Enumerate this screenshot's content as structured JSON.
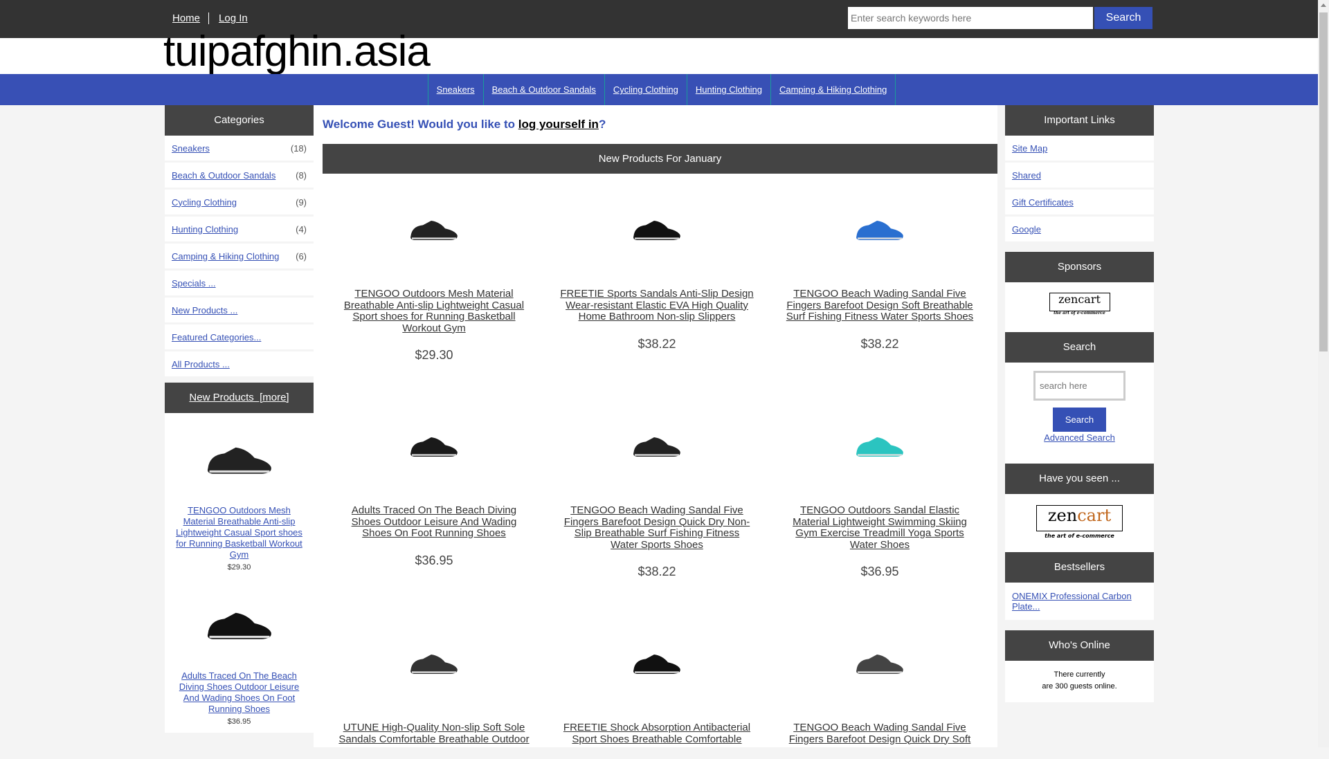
{
  "top": {
    "home": "Home",
    "login": "Log In",
    "search_placeholder": "Enter search keywords here",
    "search_btn": "Search"
  },
  "logo": "tuipafghin.asia",
  "nav": [
    "Sneakers",
    "Beach & Outdoor Sandals",
    "Cycling Clothing",
    "Hunting Clothing",
    "Camping & Hiking Clothing"
  ],
  "categories": {
    "title": "Categories",
    "items": [
      {
        "label": "Sneakers",
        "count": "(18)"
      },
      {
        "label": "Beach & Outdoor Sandals",
        "count": "(8)"
      },
      {
        "label": "Cycling Clothing",
        "count": "(9)"
      },
      {
        "label": "Hunting Clothing",
        "count": "(4)"
      },
      {
        "label": "Camping & Hiking Clothing",
        "count": "(6)"
      },
      {
        "label": "Specials ...",
        "count": ""
      },
      {
        "label": "New Products ...",
        "count": ""
      },
      {
        "label": "Featured Categories...",
        "count": ""
      },
      {
        "label": "All Products ...",
        "count": ""
      }
    ]
  },
  "side_new": {
    "title": "New Products  [more]",
    "items": [
      {
        "title": "TENGOO Outdoors Mesh Material Breathable Anti-slip Lightweight Casual Sport shoes for Running Basketball Workout Gym",
        "price": "$29.30"
      },
      {
        "title": "Adults Traced On The Beach Diving Shoes Outdoor Leisure And Wading Shoes On Foot Running Shoes",
        "price": "$36.95"
      }
    ]
  },
  "welcome": {
    "text": "Welcome Guest! Would you like to ",
    "link": "log yourself in",
    "end": "?"
  },
  "new_products": {
    "title": "New Products For January",
    "items": [
      {
        "title": "TENGOO Outdoors Mesh Material Breathable Anti-slip Lightweight Casual Sport shoes for Running Basketball Workout Gym",
        "price": "$29.30",
        "color": "#222"
      },
      {
        "title": "FREETIE Sports Sandals Anti-Slip Design Wear-resistant Elastic EVA High Quality Home Bathroom Non-slip Slippers",
        "price": "$38.22",
        "color": "#111"
      },
      {
        "title": "TENGOO Beach Wading Sandal Five Fingers Barefoot Design Soft Breathable Surf Fishing Fitness Water Sports Shoes",
        "price": "$38.22",
        "color": "#2a6fd0"
      },
      {
        "title": "Adults Traced On The Beach Diving Shoes Outdoor Leisure And Wading Shoes On Foot Running Shoes",
        "price": "$36.95",
        "color": "#1a1a1a"
      },
      {
        "title": "TENGOO Beach Wading Sandal Five Fingers Barefoot Design Quick Dry Non-Slip Breathable Surf Fishing Fitness Water Sports Shoes",
        "price": "$38.22",
        "color": "#222"
      },
      {
        "title": "TENGOO Outdoors Sandal Elastic Material Lightweight Swimming Skiing Gym Exercise Treadmill Yoga Sports Water Shoes",
        "price": "$36.95",
        "color": "#2bc4c0"
      },
      {
        "title": "UTUNE High-Quality Non-slip Soft Sole Sandals Comfortable Breathable Outdoor",
        "price": "",
        "color": "#333"
      },
      {
        "title": "FREETIE Shock Absorption Antibacterial Sport Shoes Breathable Comfortable",
        "price": "",
        "color": "#111"
      },
      {
        "title": "TENGOO Beach Wading Sandal Five Fingers Barefoot Design Quick Dry Soft",
        "price": "",
        "color": "#444"
      }
    ]
  },
  "important": {
    "title": "Important Links",
    "items": [
      "Site Map",
      "Shared",
      "Gift Certificates",
      "Google"
    ]
  },
  "sponsors": {
    "title": "Sponsors",
    "logo": "zencart the art of e-commerce"
  },
  "search": {
    "title": "Search",
    "placeholder": "search here",
    "btn": "Search",
    "advanced": "Advanced Search"
  },
  "seen": {
    "title": "Have you seen ...",
    "logo": "zencart the art of e-commerce"
  },
  "bestsellers": {
    "title": "Bestsellers",
    "items": [
      "ONEMIX Professional Carbon Plate..."
    ]
  },
  "online": {
    "title": "Who's Online",
    "line1": "There currently",
    "line2": "are 300 guests online."
  }
}
